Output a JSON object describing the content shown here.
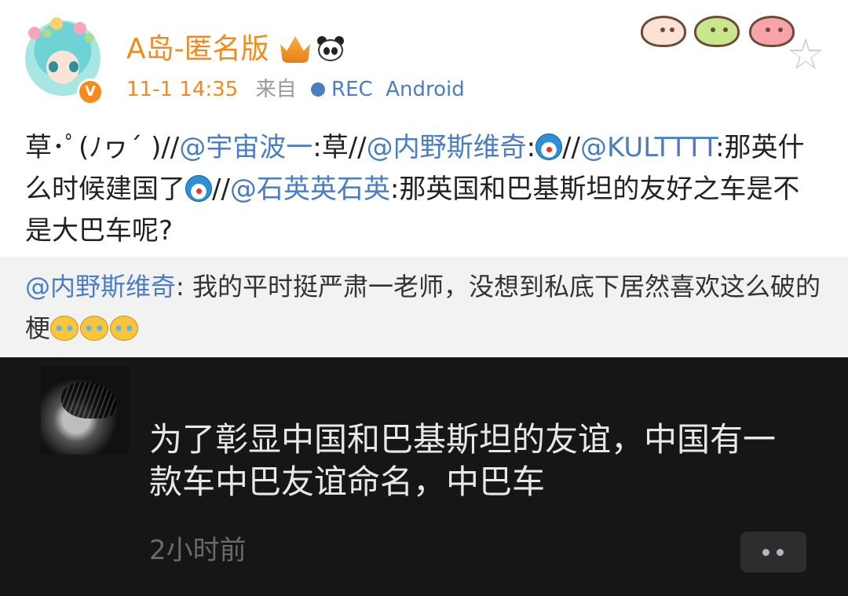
{
  "header": {
    "username": "A岛-匿名版",
    "time": "11-1 14:35",
    "from_label": "来自",
    "source": "REC  Android",
    "verified_mark": "V"
  },
  "post": {
    "segments": [
      {
        "t": "草･ﾟ(ﾉヮ´ )//",
        "m": false
      },
      {
        "t": "@宇宙波一",
        "m": true
      },
      {
        "t": ":草//",
        "m": false
      },
      {
        "t": "@内野斯维奇",
        "m": true
      },
      {
        "t": ":",
        "m": false
      },
      {
        "e": "doraemon"
      },
      {
        "t": "//",
        "m": false
      },
      {
        "t": "@KULTTTT",
        "m": true
      },
      {
        "t": ":那英什么时候建国了",
        "m": false
      },
      {
        "e": "doraemon"
      },
      {
        "t": "//",
        "m": false
      },
      {
        "t": "@石英英石英",
        "m": true
      },
      {
        "t": ":那英国和巴基斯坦的友好之车是不是大巴车呢?",
        "m": false
      }
    ]
  },
  "quote": {
    "mention": "@内野斯维奇",
    "text": ": 我的平时挺严肃一老师，没想到私底下居然喜欢这么破的梗",
    "emoji_count": 3
  },
  "reply": {
    "text": "为了彰显中国和巴基斯坦的友谊，中国有一款车中巴友谊命名，中巴车",
    "time": "2小时前"
  },
  "colors": {
    "username": "#f28a1c",
    "mention": "#4b7ec0",
    "dark_bg": "#161616"
  }
}
